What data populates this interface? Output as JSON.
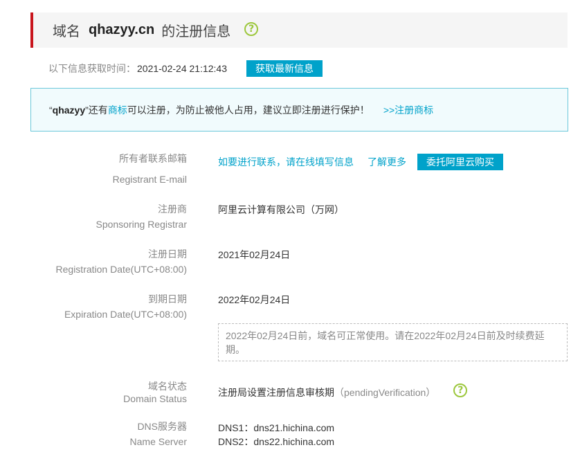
{
  "header": {
    "prefix": "域名",
    "domain": "qhazyy.cn",
    "suffix": "的注册信息",
    "help_icon": "question-circle-icon"
  },
  "fetch": {
    "label": "以下信息获取时间：",
    "time": "2021-02-24 21:12:43",
    "button": "获取最新信息"
  },
  "notice": {
    "open_quote": "“",
    "name": "qhazyy",
    "mid1": "”还有",
    "trademark_link": "商标",
    "mid2": "可以注册，为防止被他人占用，建议立即注册进行保护！",
    "register_link": ">>注册商标"
  },
  "fields": {
    "email": {
      "label_cn": "所有者联系邮箱",
      "label_en": "Registrant E-mail",
      "contact_link": "如要进行联系，请在线填写信息",
      "learn_more": "了解更多",
      "buy_button": "委托阿里云购买"
    },
    "registrar": {
      "label_cn": "注册商",
      "label_en": "Sponsoring Registrar",
      "value": "阿里云计算有限公司（万网）"
    },
    "reg_date": {
      "label_cn": "注册日期",
      "label_en": "Registration Date(UTC+08:00)",
      "value": "2021年02月24日"
    },
    "exp_date": {
      "label_cn": "到期日期",
      "label_en": "Expiration Date(UTC+08:00)",
      "value": "2022年02月24日",
      "note": "2022年02月24日前，域名可正常使用。请在2022年02月24日前及时续费延期。"
    },
    "status": {
      "label_cn": "域名状态",
      "label_en": "Domain Status",
      "value_cn": "注册局设置注册信息审核期",
      "value_en": "（pendingVerification）",
      "help_icon": "question-circle-icon"
    },
    "dns": {
      "label_cn": "DNS服务器",
      "label_en": "Name Server",
      "values": [
        "DNS1：dns21.hichina.com",
        "DNS2：dns22.hichina.com"
      ]
    }
  },
  "colors": {
    "accent": "#00a2ca",
    "title_border": "#c8151d",
    "help_green": "#9cc73c"
  }
}
